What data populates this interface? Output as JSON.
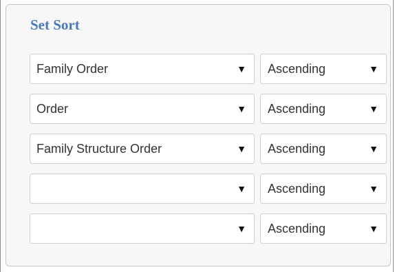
{
  "panel": {
    "title": "Set Sort"
  },
  "rows": [
    {
      "field": "Family Order",
      "direction": "Ascending"
    },
    {
      "field": "Order",
      "direction": "Ascending"
    },
    {
      "field": "Family Structure Order",
      "direction": "Ascending"
    },
    {
      "field": "",
      "direction": "Ascending"
    },
    {
      "field": "",
      "direction": "Ascending"
    }
  ],
  "icons": {
    "dropdown_arrow": "▼"
  },
  "colors": {
    "title": "#4a78b5",
    "panel_background": "#f7f7f7",
    "field_border": "#cfcfcf"
  }
}
